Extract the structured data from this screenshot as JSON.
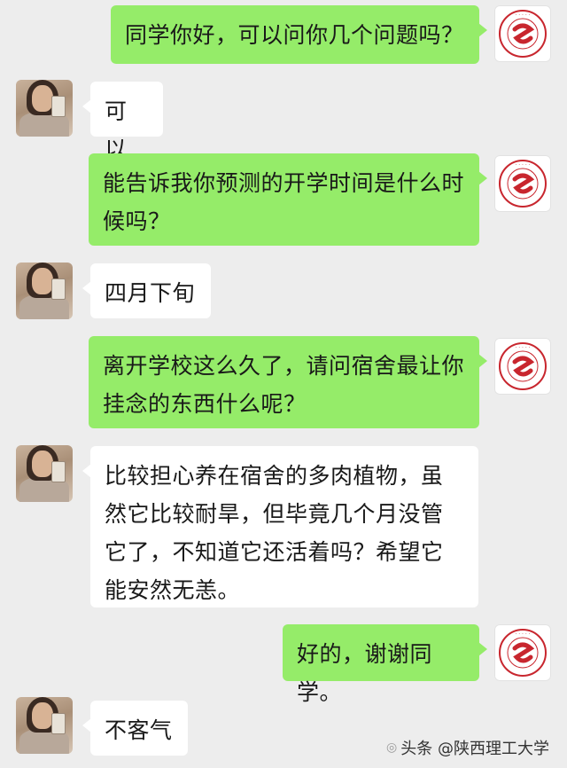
{
  "messages": [
    {
      "side": "right",
      "text": "同学你好，可以问你几个问题吗？"
    },
    {
      "side": "left",
      "text": "可以"
    },
    {
      "side": "right",
      "text": "能告诉我你预测的开学时间是什么时候吗？"
    },
    {
      "side": "left",
      "text": "四月下旬"
    },
    {
      "side": "right",
      "text": "离开学校这么久了，请问宿舍最让你挂念的东西什么呢？"
    },
    {
      "side": "left",
      "text": "比较担心养在宿舍的多肉植物，虽然它比较耐旱，但毕竟几个月没管它了，不知道它还活着吗？希望它能安然无恙。"
    },
    {
      "side": "right",
      "text": "好的，谢谢同学。"
    },
    {
      "side": "left",
      "text": "不客气"
    }
  ],
  "watermark": {
    "text": "头条 @陕西理工大学",
    "icon": "toutiao-logo-icon"
  },
  "colors": {
    "background": "#ededed",
    "sent_bubble": "#95ec69",
    "received_bubble": "#ffffff",
    "seal_red": "#c8262e"
  },
  "avatars": {
    "sender_icon": "university-seal-icon",
    "receiver_icon": "student-photo-icon"
  }
}
